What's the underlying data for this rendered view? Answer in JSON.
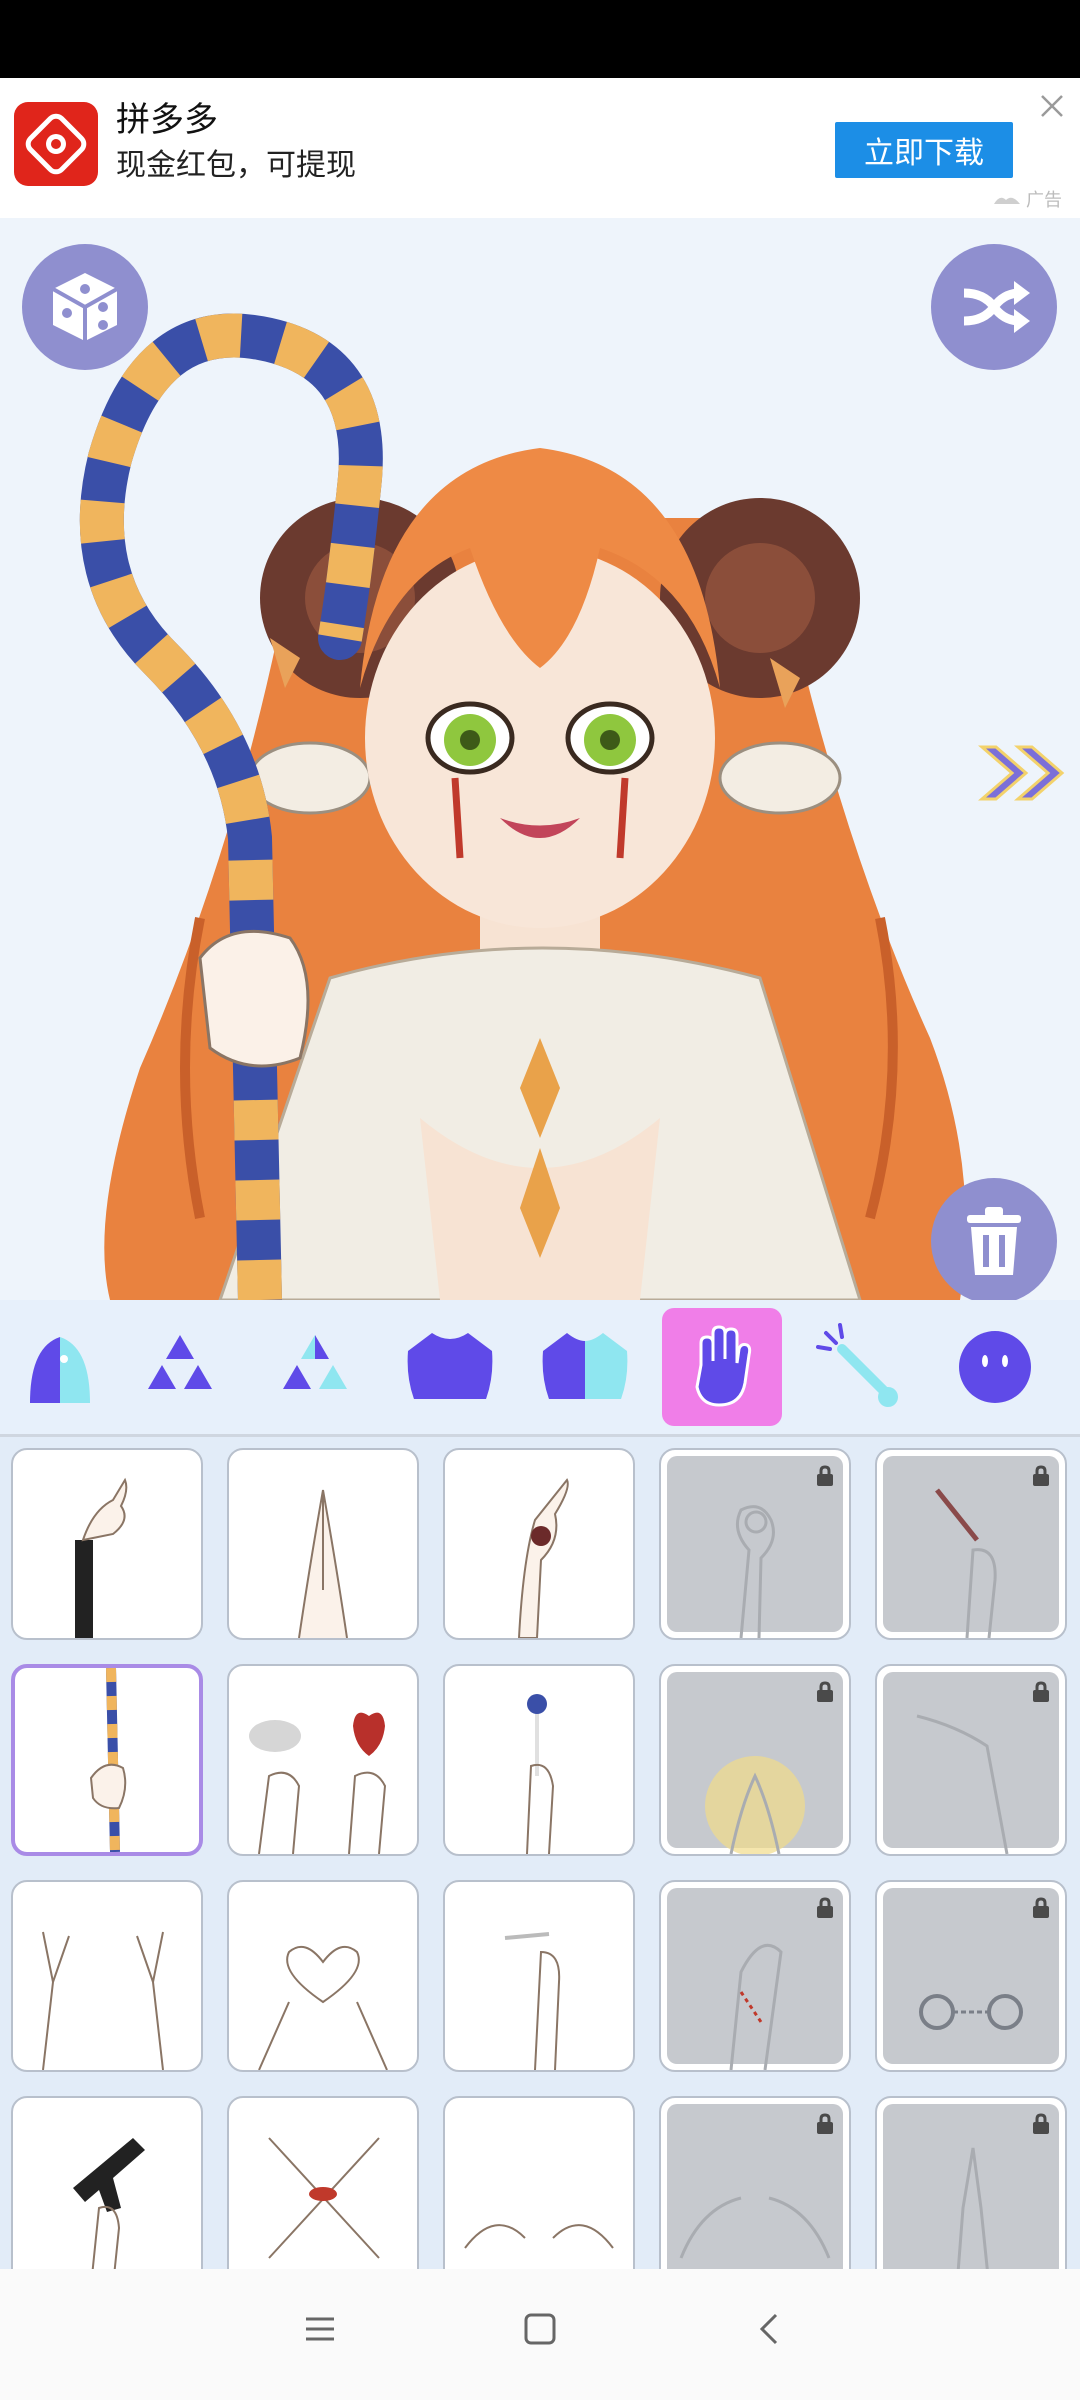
{
  "ad": {
    "app_name": "拼多多",
    "subtitle": "现金红包，可提现",
    "download_label": "立即下载",
    "tag": "广告"
  },
  "canvas": {
    "random_icon": "dice-icon",
    "shuffle_icon": "shuffle-icon",
    "next_icon": "double-chevron-right-icon",
    "delete_icon": "trash-icon"
  },
  "categories": [
    {
      "name": "body-shape",
      "icon": "body-icon",
      "active": false
    },
    {
      "name": "triangle-set-1",
      "icon": "triangle-icon",
      "active": false
    },
    {
      "name": "triangle-set-2",
      "icon": "triangle-half-icon",
      "active": false
    },
    {
      "name": "top-clothes",
      "icon": "shirt-icon",
      "active": false
    },
    {
      "name": "outfit",
      "icon": "shirt-split-icon",
      "active": false
    },
    {
      "name": "hands",
      "icon": "hand-icon",
      "active": true
    },
    {
      "name": "accessory",
      "icon": "wand-icon",
      "active": false
    },
    {
      "name": "face",
      "icon": "face-icon",
      "active": false
    }
  ],
  "items": [
    {
      "pose": "point-black-sleeve",
      "locked": false,
      "selected": false
    },
    {
      "pose": "pray-hands",
      "locked": false,
      "selected": false
    },
    {
      "pose": "point-rose-tattoo",
      "locked": false,
      "selected": false
    },
    {
      "pose": "ok-sign",
      "locked": true,
      "selected": false
    },
    {
      "pose": "syringe",
      "locked": true,
      "selected": false
    },
    {
      "pose": "shepherd-staff",
      "locked": false,
      "selected": true
    },
    {
      "pose": "feather-and-heart",
      "locked": false,
      "selected": false
    },
    {
      "pose": "lollipop",
      "locked": false,
      "selected": false
    },
    {
      "pose": "glowing-hands",
      "locked": true,
      "selected": false
    },
    {
      "pose": "open-palm",
      "locked": true,
      "selected": false
    },
    {
      "pose": "peace-signs",
      "locked": false,
      "selected": false
    },
    {
      "pose": "heart-hands",
      "locked": false,
      "selected": false
    },
    {
      "pose": "cigarette",
      "locked": false,
      "selected": false
    },
    {
      "pose": "bloody-hand",
      "locked": true,
      "selected": false
    },
    {
      "pose": "handcuffs",
      "locked": true,
      "selected": false
    },
    {
      "pose": "gun",
      "locked": false,
      "selected": false
    },
    {
      "pose": "crossed-hands-lips",
      "locked": false,
      "selected": false
    },
    {
      "pose": "spread-hands",
      "locked": false,
      "selected": false
    },
    {
      "pose": "pointing-both",
      "locked": true,
      "selected": false
    },
    {
      "pose": "raised-finger",
      "locked": true,
      "selected": false
    }
  ],
  "colors": {
    "accent": "#5f4ae8",
    "active_tab": "#f07ee8",
    "round_button": "#8f8fcf",
    "ad_button": "#1c8ee6"
  },
  "navbar": {
    "menu_icon": "menu-icon",
    "home_icon": "home-icon",
    "back_icon": "back-icon"
  }
}
